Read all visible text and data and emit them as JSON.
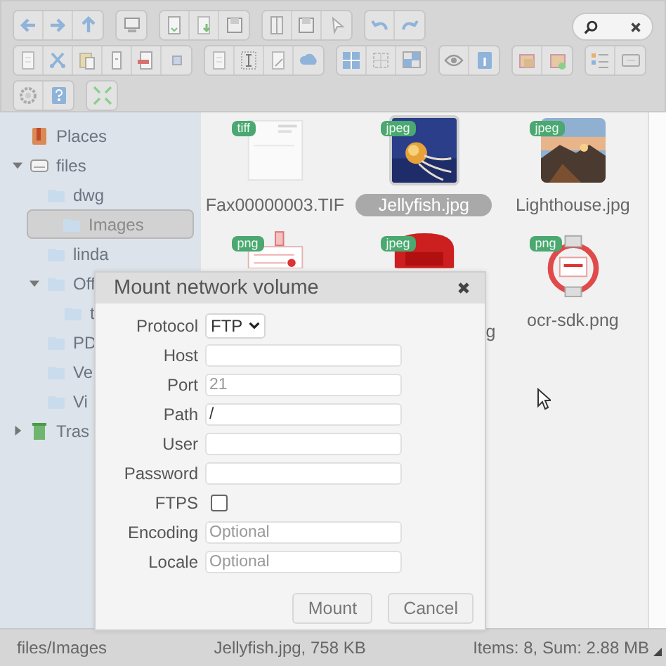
{
  "sidebar": {
    "items": [
      {
        "label": "Places",
        "kind": "places",
        "selected": false
      },
      {
        "label": "files",
        "kind": "drive",
        "expanded": true,
        "selected": false,
        "children": [
          {
            "label": "dwg",
            "kind": "folder",
            "selected": false
          },
          {
            "label": "Images",
            "kind": "folder",
            "selected": true
          },
          {
            "label": "linda",
            "kind": "folder",
            "selected": false
          },
          {
            "label": "Off",
            "kind": "folder",
            "expanded": true,
            "selected": false,
            "children": [
              {
                "label": "t",
                "kind": "folder",
                "selected": false
              }
            ]
          },
          {
            "label": "PD",
            "kind": "folder",
            "selected": false
          },
          {
            "label": "Ve",
            "kind": "folder",
            "selected": false
          },
          {
            "label": "Vi",
            "kind": "folder",
            "selected": false
          }
        ]
      },
      {
        "label": "Tras",
        "kind": "trash",
        "expanded": false,
        "selected": false
      }
    ]
  },
  "files": [
    {
      "name": "Fax00000003.TIF",
      "badge": "tiff",
      "selected": false
    },
    {
      "name": "Jellyfish.jpg",
      "badge": "jpeg",
      "selected": true
    },
    {
      "name": "Lighthouse.jpg",
      "badge": "jpeg",
      "selected": false
    },
    {
      "badge": "png",
      "selected": false
    },
    {
      "name": "g",
      "badge": "jpeg",
      "selected": false
    },
    {
      "name": "ocr-sdk.png",
      "badge": "png",
      "selected": false
    }
  ],
  "dialog": {
    "title": "Mount network volume",
    "fields": [
      {
        "label": "Protocol",
        "kind": "select",
        "value": "FTP"
      },
      {
        "label": "Host",
        "kind": "text"
      },
      {
        "label": "Port",
        "kind": "text",
        "placeholder": "21"
      },
      {
        "label": "Path",
        "kind": "text",
        "value": "/"
      },
      {
        "label": "User",
        "kind": "text"
      },
      {
        "label": "Password",
        "kind": "password"
      },
      {
        "label": "FTPS",
        "kind": "checkbox",
        "checked": false
      },
      {
        "label": "Encoding",
        "kind": "text",
        "placeholder": "Optional"
      },
      {
        "label": "Locale",
        "kind": "text",
        "placeholder": "Optional"
      }
    ],
    "buttons": [
      "Mount",
      "Cancel"
    ]
  },
  "status_bar": {
    "path": "files/Images",
    "selection": "Jellyfish.jpg, 758 KB",
    "summary": "Items: 8, Sum: 2.88 MB"
  }
}
